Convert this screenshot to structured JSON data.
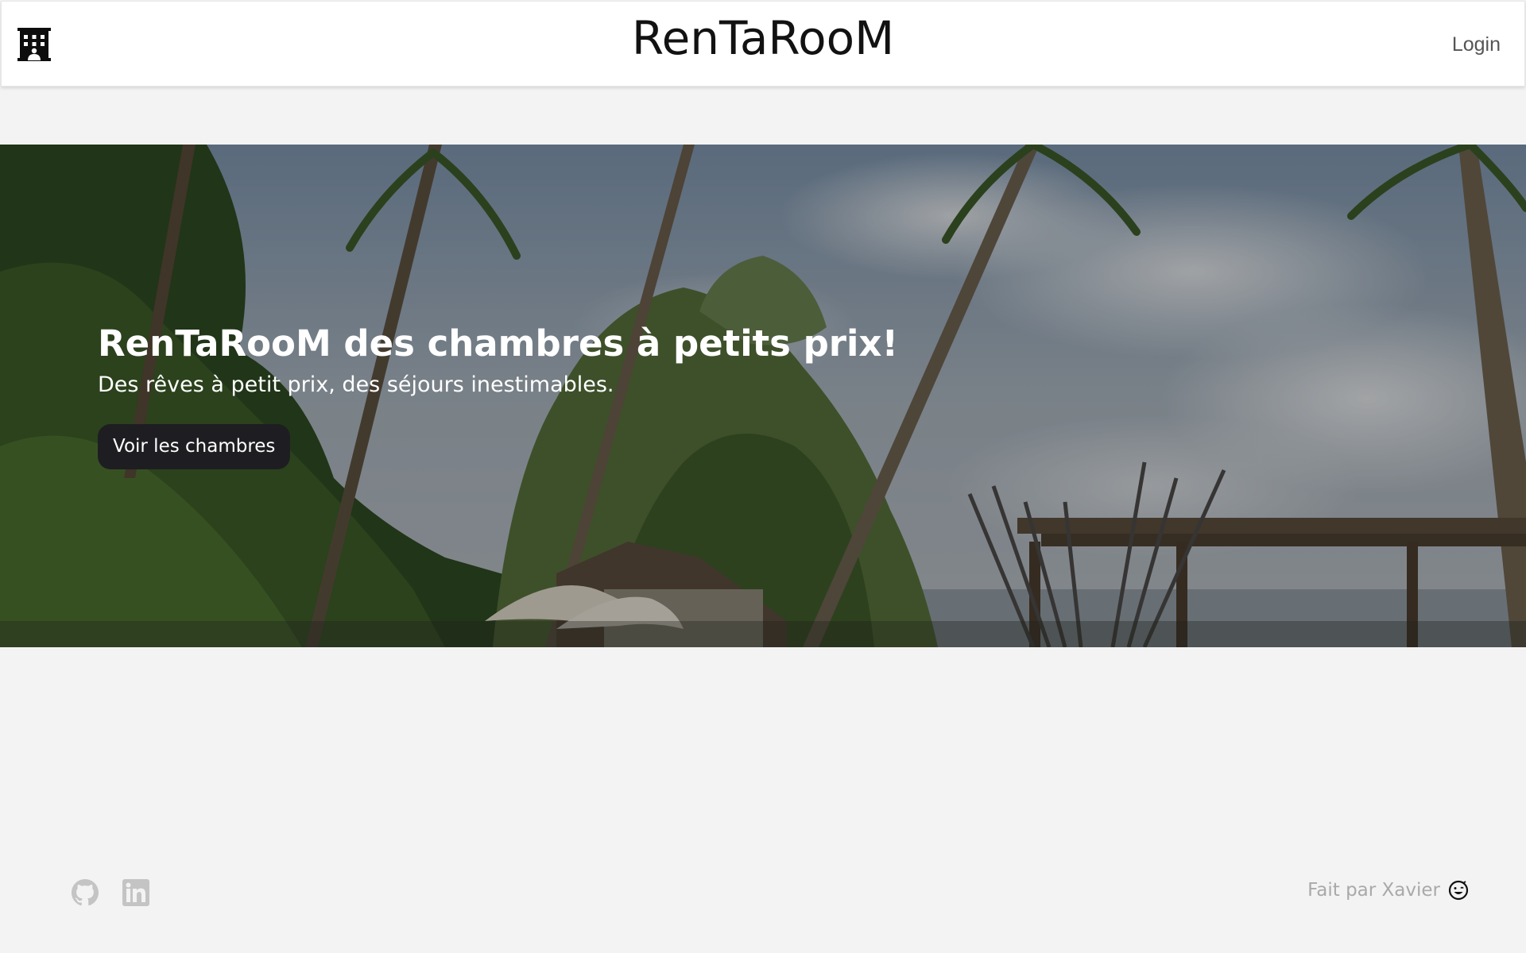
{
  "header": {
    "logo_icon": "hotel-building-icon",
    "title": "RenTaRooM",
    "login_label": "Login"
  },
  "hero": {
    "background": "tropical-beach-palm-trees-photo",
    "title": "RenTaRooM des chambres à petits prix!",
    "subtitle": "Des rêves à petit prix, des séjours inestimables.",
    "cta_label": "Voir les chambres"
  },
  "footer": {
    "icons": [
      "github-icon",
      "linkedin-icon"
    ],
    "credit": "Fait par Xavier",
    "credit_icon": "smiling-face-icon"
  },
  "colors": {
    "page_background": "#f3f3f3",
    "header_background": "#ffffff",
    "button_background": "#1e1e22",
    "footer_text": "#a9a9a9"
  }
}
